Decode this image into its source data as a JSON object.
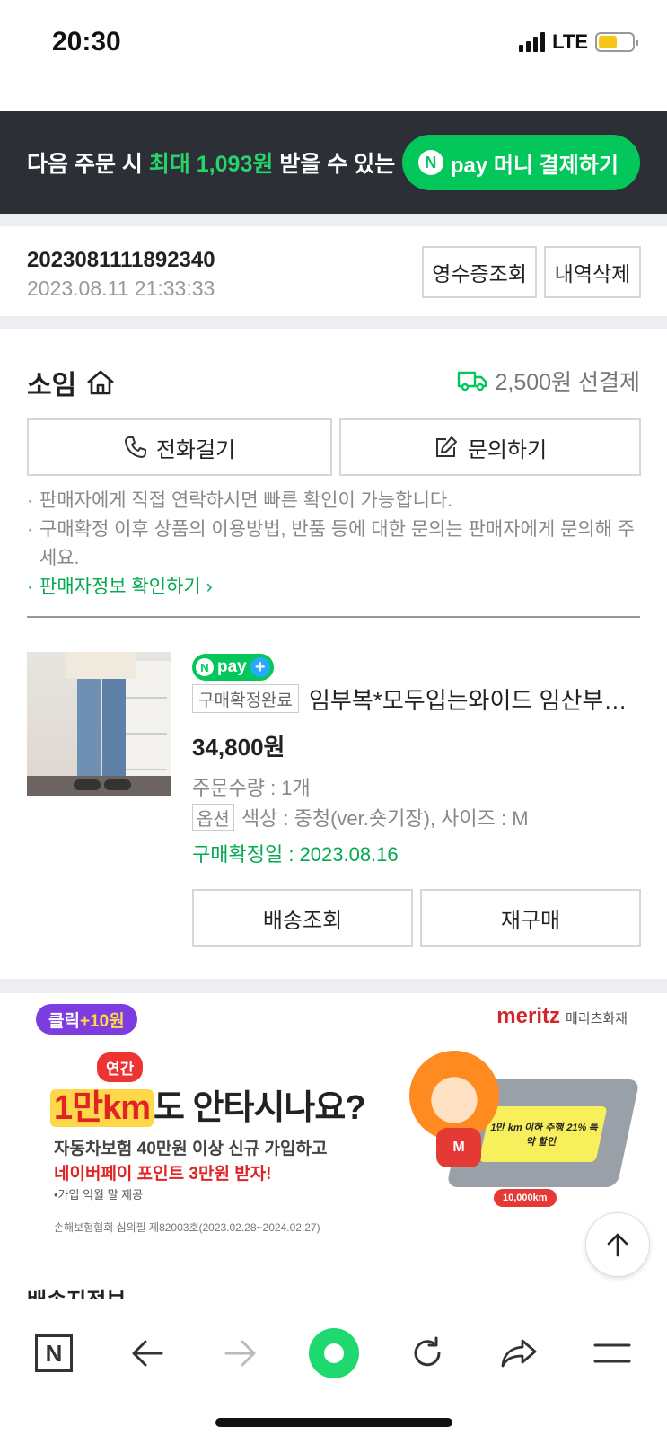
{
  "status_bar": {
    "time": "20:30",
    "network": "LTE"
  },
  "promo": {
    "text_before": "다음 주문 시 ",
    "text_highlight": "최대 1,093원",
    "text_after": " 받을 수 있는",
    "pay_button_logo": "N",
    "pay_button_label": "pay 머니 결제하기"
  },
  "order": {
    "number": "2023081111892340",
    "datetime": "2023.08.11 21:33:33",
    "receipt_button": "영수증조회",
    "delete_button": "내역삭제"
  },
  "seller": {
    "name": "소임",
    "shipping": "2,500원 선결제",
    "call_button": "전화걸기",
    "inquiry_button": "문의하기",
    "notes": [
      "판매자에게 직접 연락하시면 빠른 확인이 가능합니다.",
      "구매확정 이후 상품의 이용방법, 반품 등에 대한 문의는 판매자에게 문의해 주세요."
    ],
    "info_link": "판매자정보 확인하기"
  },
  "product": {
    "npay_badge": "pay",
    "status_badge": "구매확정완료",
    "name": "임부복*모두입는와이드 임산부청바지",
    "price": "34,800원",
    "quantity": "주문수량 : 1개",
    "option_tag": "옵션",
    "option_text": "색상 : 중청(ver.숏기장), 사이즈 : M",
    "confirm_date": "구매확정일 : 2023.08.16",
    "track_button": "배송조회",
    "rebuy_button": "재구매"
  },
  "ad": {
    "pill_prefix": "클릭",
    "pill_reward": "+10원",
    "brand": "meritz",
    "brand_sub": "메리츠화재",
    "yearly_badge": "연간",
    "headline_highlight": "1만km",
    "headline_rest": "도 안타시나요?",
    "line1": "자동차보험 40만원 이상 신규 가입하고",
    "line2": "네이버페이 포인트 3만원 받자!",
    "line3": "•가입 익월 말 제공",
    "line4": "손해보험협회 심의필 제82003호(2023.02.28~2024.02.27)",
    "board_text": "1만 km 이하 주행 21% 특약 할인",
    "board_km": "10,000km",
    "mascot_mark": "M"
  },
  "bottom_nav": {
    "peek_title": "배송지정보",
    "n_logo": "N",
    "icons": [
      "n-home-icon",
      "back-arrow-icon",
      "forward-arrow-icon",
      "green-dot-icon",
      "refresh-icon",
      "share-icon",
      "menu-icon"
    ]
  },
  "colors": {
    "naver_green": "#03c75a",
    "promo_bg": "#2c3036",
    "highlight_green": "#27d36a",
    "ad_purple": "#7d3ce0",
    "meritz_red": "#d3242b"
  }
}
